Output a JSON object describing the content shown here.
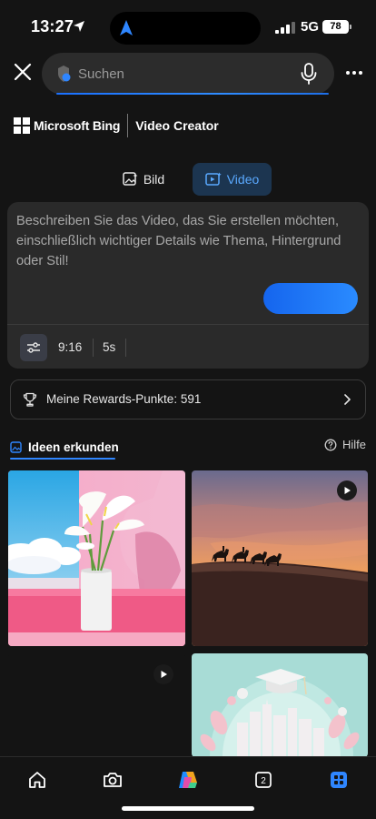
{
  "status_bar": {
    "time": "13:27",
    "network": "5G",
    "battery": "78"
  },
  "search": {
    "placeholder": "Suchen"
  },
  "brand": {
    "company": "Microsoft Bing",
    "product": "Video Creator"
  },
  "tabs": [
    {
      "label": "Bild",
      "selected": false
    },
    {
      "label": "Video",
      "selected": true
    }
  ],
  "prompt": {
    "placeholder": "Beschreiben Sie das Video, das Sie erstellen möchten, einschließlich wichtiger Details wie Thema, Hintergrund oder Stil!",
    "aspect_ratio": "9:16",
    "duration": "5s"
  },
  "rewards": {
    "label": "Meine Rewards-Punkte: 591"
  },
  "explore": {
    "tab_label": "Ideen erkunden",
    "help_label": "Hilfe"
  },
  "bottom_nav": {
    "items": [
      {
        "icon": "home-icon"
      },
      {
        "icon": "camera-icon"
      },
      {
        "icon": "copilot-icon"
      },
      {
        "icon": "tabs-icon",
        "count": "2"
      },
      {
        "icon": "apps-icon"
      }
    ]
  },
  "colors": {
    "accent": "#2f86ff",
    "background": "#141414",
    "card": "#2a2a2a"
  }
}
